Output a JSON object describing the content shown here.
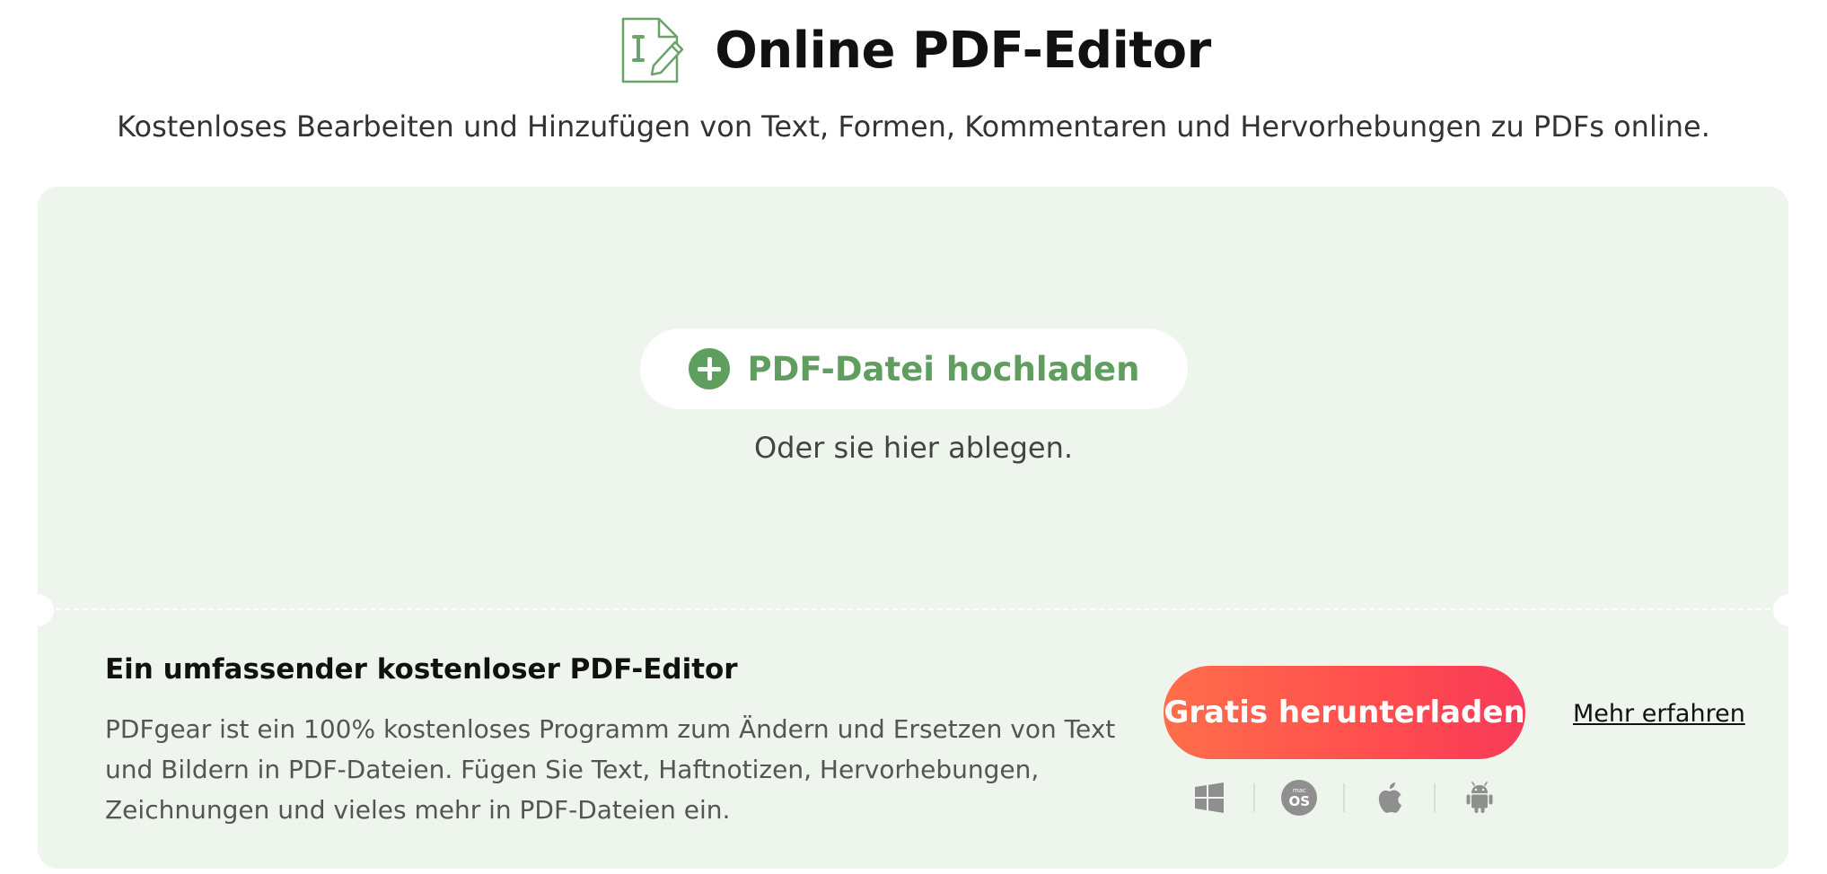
{
  "header": {
    "title": "Online PDF-Editor",
    "subtitle": "Kostenloses Bearbeiten und Hinzufügen von Text, Formen, Kommentaren und Hervorhebungen zu PDFs online.",
    "icon": "document-edit-icon"
  },
  "upload": {
    "button_label": "PDF-Datei hochladen",
    "drop_hint": "Oder sie hier ablegen.",
    "icon": "plus-circle-icon"
  },
  "promo": {
    "title": "Ein umfassender kostenloser PDF-Editor",
    "description": "PDFgear ist ein 100% kostenloses Programm zum Ändern und Ersetzen von Text und Bildern in PDF-Dateien. Fügen Sie Text, Haftnotizen, Hervorhebungen, Zeichnungen und vieles mehr in PDF-Dateien ein.",
    "download_label": "Gratis herunterladen",
    "more_link": "Mehr erfahren",
    "platforms": [
      "windows-icon",
      "macos-icon",
      "apple-icon",
      "android-icon"
    ],
    "macos_badge_small": "mac",
    "macos_badge_text": "OS"
  },
  "colors": {
    "brand_green": "#5f9e5f",
    "card_bg": "#eef5ec",
    "download_gradient_start": "#ff6e4a",
    "download_gradient_end": "#f83a58",
    "platform_icon": "#8f8f8f"
  }
}
